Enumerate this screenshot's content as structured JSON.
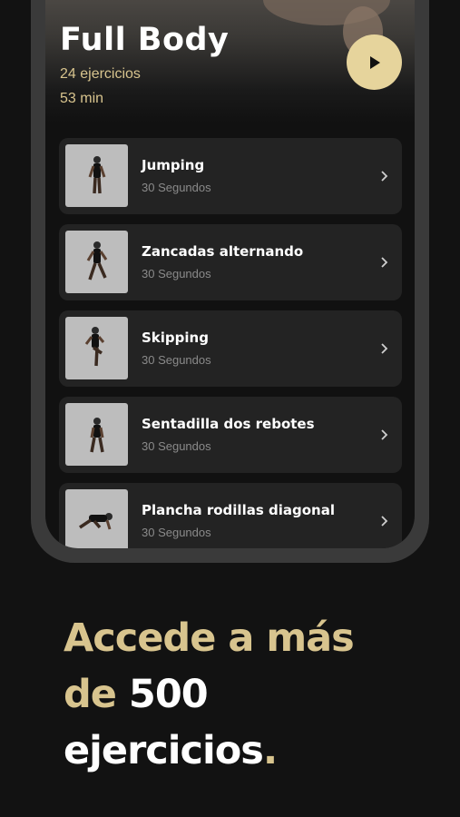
{
  "workout": {
    "title": "Full Body",
    "exercise_count": "24 ejercicios",
    "duration": "53 min"
  },
  "play_icon": "play-icon",
  "exercises": [
    {
      "name": "Jumping",
      "duration": "30 Segundos"
    },
    {
      "name": "Zancadas alternando",
      "duration": "30 Segundos"
    },
    {
      "name": "Skipping",
      "duration": "30 Segundos"
    },
    {
      "name": "Sentadilla dos rebotes",
      "duration": "30 Segundos"
    },
    {
      "name": "Plancha rodillas diagonal",
      "duration": "30 Segundos"
    }
  ],
  "headline": {
    "line1": "Accede a más",
    "line2_gold": "de",
    "line2_white": " 500",
    "line3_white": "ejercicios",
    "line3_gold": "."
  },
  "colors": {
    "accent_gold": "#d8c48e",
    "play_button": "#e6d49c",
    "background": "#121212",
    "card": "#232323"
  }
}
